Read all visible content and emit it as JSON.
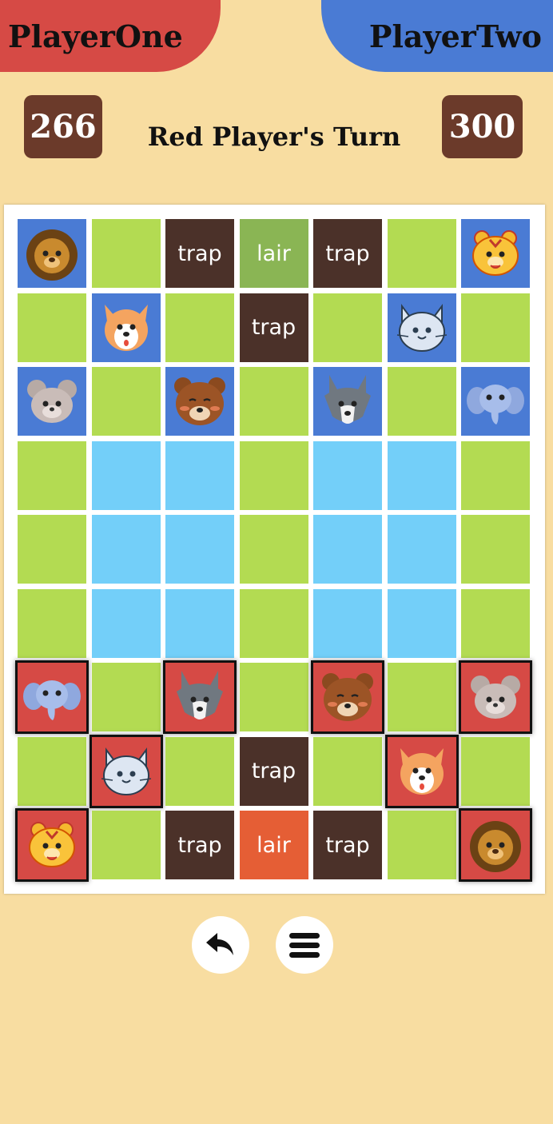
{
  "players": {
    "red": {
      "name": "PlayerOne",
      "score": "266",
      "color": "#d64a45"
    },
    "blue": {
      "name": "PlayerTwo",
      "score": "300",
      "color": "#4a7bd4"
    }
  },
  "status": {
    "turn_text": "Red Player's Turn"
  },
  "labels": {
    "trap": "trap",
    "lair": "lair"
  },
  "board": {
    "rows": 9,
    "cols": 7,
    "cells": [
      [
        "lion-blue",
        "land",
        "trap",
        "lair-blue",
        "trap",
        "land",
        "tiger-blue"
      ],
      [
        "land",
        "dog-blue",
        "land",
        "trap",
        "land",
        "cat-blue",
        "land"
      ],
      [
        "rat-blue",
        "land",
        "bear-blue",
        "land",
        "wolf-blue",
        "land",
        "elephant-blue"
      ],
      [
        "land",
        "water",
        "water",
        "land",
        "water",
        "water",
        "land"
      ],
      [
        "land",
        "water",
        "water",
        "land",
        "water",
        "water",
        "land"
      ],
      [
        "land",
        "water",
        "water",
        "land",
        "water",
        "water",
        "land"
      ],
      [
        "elephant-red",
        "land",
        "wolf-red",
        "land",
        "bear-red",
        "land",
        "rat-red"
      ],
      [
        "land",
        "cat-red",
        "land",
        "trap",
        "land",
        "dog-red",
        "land"
      ],
      [
        "tiger-red",
        "land",
        "trap",
        "lair-red",
        "trap",
        "land",
        "lion-red"
      ]
    ]
  },
  "controls": {
    "undo": "undo-icon",
    "menu": "menu-icon"
  }
}
